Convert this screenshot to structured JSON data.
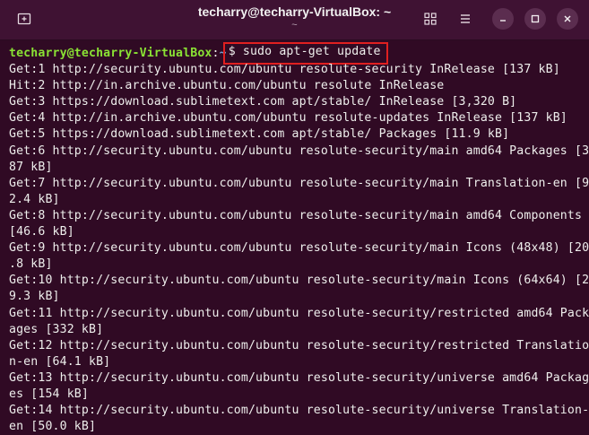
{
  "window": {
    "title": "techarry@techarry-VirtualBox: ~",
    "subtitle": "~",
    "buttons": {
      "new_tab_icon": "new-tab-icon",
      "view_icon": "grid-view-icon",
      "menu_icon": "hamburger-menu-icon",
      "minimize_icon": "minimize-icon",
      "maximize_icon": "maximize-icon",
      "close_icon": "close-icon"
    }
  },
  "colors": {
    "terminal_bg": "#300a24",
    "titlebar_bg": "#3f1233",
    "prompt_user": "#8ae234",
    "prompt_path": "#729fcf",
    "highlight_box": "#e02020",
    "text": "#eeeeec"
  },
  "terminal": {
    "prompt": {
      "user_host": "techarry@techarry-VirtualBox",
      "colon": ":",
      "path": "~",
      "command": "$ sudo apt-get update"
    },
    "output": [
      "Get:1 http://security.ubuntu.com/ubuntu resolute-security InRelease [137 kB]",
      "Hit:2 http://in.archive.ubuntu.com/ubuntu resolute InRelease",
      "Get:3 https://download.sublimetext.com apt/stable/ InRelease [3,320 B]",
      "Get:4 http://in.archive.ubuntu.com/ubuntu resolute-updates InRelease [137 kB]",
      "Get:5 https://download.sublimetext.com apt/stable/ Packages [11.9 kB]",
      "Get:6 http://security.ubuntu.com/ubuntu resolute-security/main amd64 Packages [3",
      "87 kB]",
      "Get:7 http://security.ubuntu.com/ubuntu resolute-security/main Translation-en [9",
      "2.4 kB]",
      "Get:8 http://security.ubuntu.com/ubuntu resolute-security/main amd64 Components",
      "[46.6 kB]",
      "Get:9 http://security.ubuntu.com/ubuntu resolute-security/main Icons (48x48) [20",
      ".8 kB]",
      "Get:10 http://security.ubuntu.com/ubuntu resolute-security/main Icons (64x64) [2",
      "9.3 kB]",
      "Get:11 http://security.ubuntu.com/ubuntu resolute-security/restricted amd64 Pack",
      "ages [332 kB]",
      "Get:12 http://security.ubuntu.com/ubuntu resolute-security/restricted Translatio",
      "n-en [64.1 kB]",
      "Get:13 http://security.ubuntu.com/ubuntu resolute-security/universe amd64 Packag",
      "es [154 kB]",
      "Get:14 http://security.ubuntu.com/ubuntu resolute-security/universe Translation-",
      "en [50.0 kB]"
    ]
  }
}
